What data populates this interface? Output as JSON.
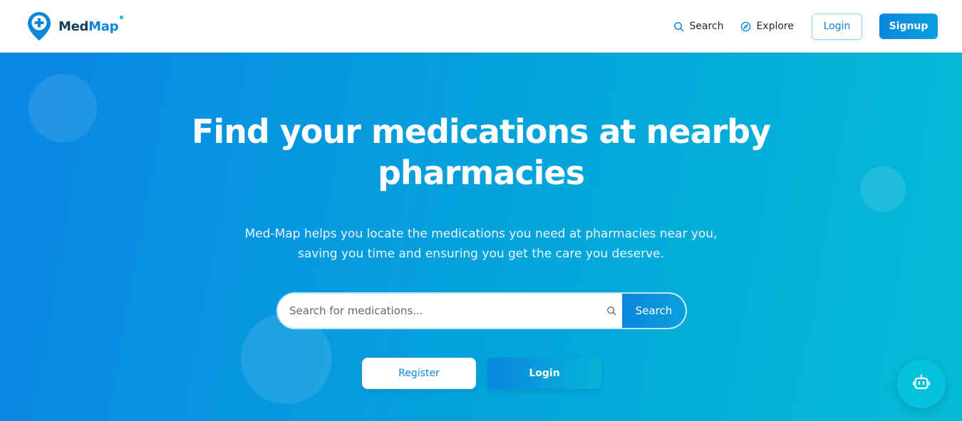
{
  "brand": {
    "name_part1": "Med",
    "name_part2": "Map",
    "icon": "map-pin-plus-icon"
  },
  "nav": {
    "search_label": "Search",
    "search_icon": "search-icon",
    "explore_label": "Explore",
    "explore_icon": "compass-icon",
    "login_label": "Login",
    "signup_label": "Signup"
  },
  "hero": {
    "title": "Find your medications at nearby pharmacies",
    "subtitle": "Med-Map helps you locate the medications you need at pharmacies near you, saving you time and ensuring you get the care you deserve.",
    "search": {
      "placeholder": "Search for medications...",
      "value": "",
      "button_label": "Search",
      "icon": "search-icon"
    },
    "register_label": "Register",
    "login_label": "Login"
  },
  "chatbot": {
    "icon": "robot-icon"
  },
  "colors": {
    "accent": "#0a86df",
    "gradient_start": "#0a86e6",
    "gradient_end": "#05bcd6",
    "brand_dark": "#133b5c",
    "chatbot": "#07c2dd"
  }
}
